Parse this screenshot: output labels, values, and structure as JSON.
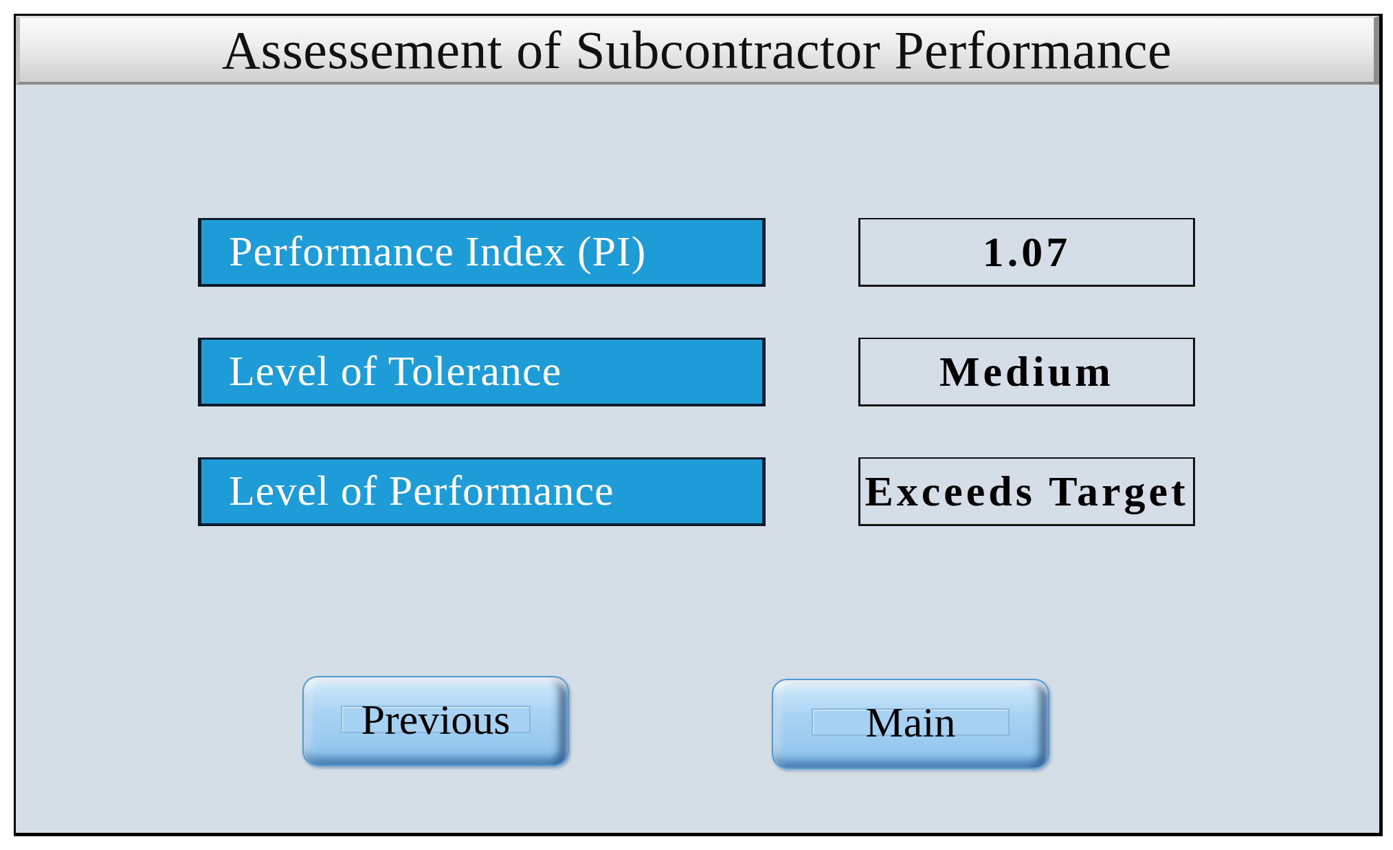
{
  "window": {
    "title": "Assessement of Subcontractor Performance"
  },
  "results": [
    {
      "label": "Performance Index (PI)",
      "value": "1.07"
    },
    {
      "label": "Level of Tolerance",
      "value": "Medium"
    },
    {
      "label": "Level of Performance",
      "value": "Exceeds Target"
    }
  ],
  "buttons": [
    {
      "label": "Previous"
    },
    {
      "label": "Main"
    }
  ]
}
